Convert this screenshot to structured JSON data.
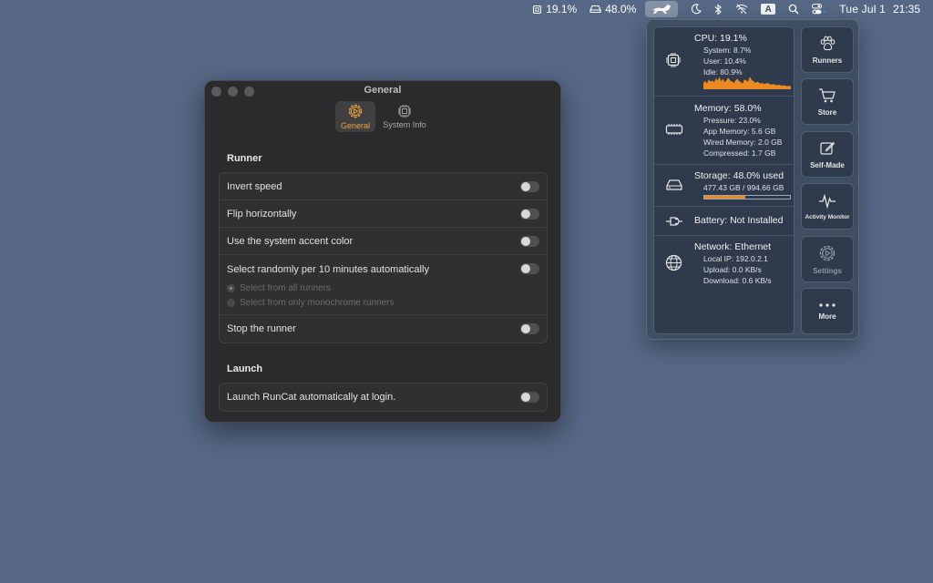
{
  "menubar": {
    "cpu_percent": "19.1%",
    "storage_percent": "48.0%",
    "input_source": "A",
    "date": "Tue Jul 1",
    "time": "21:35"
  },
  "window": {
    "title": "General",
    "tabs": [
      {
        "label": "General",
        "icon": "gear-icon",
        "active": true
      },
      {
        "label": "System Info",
        "icon": "chip-icon",
        "active": false
      }
    ],
    "runner_section": {
      "title": "Runner",
      "rows": [
        {
          "label": "Invert speed",
          "enabled": false
        },
        {
          "label": "Flip horizontally",
          "enabled": false
        },
        {
          "label": "Use the system accent color",
          "enabled": false
        },
        {
          "label": "Select randomly per 10 minutes automatically",
          "enabled": false
        },
        {
          "label": "Stop the runner",
          "enabled": false
        }
      ],
      "radio_options": [
        {
          "label": "Select from all runners",
          "selected": true
        },
        {
          "label": "Select from only monochrome runners",
          "selected": false
        }
      ]
    },
    "launch_section": {
      "title": "Launch",
      "rows": [
        {
          "label": "Launch RunCat automatically at login.",
          "enabled": false
        }
      ]
    }
  },
  "panel": {
    "cpu": {
      "title": "CPU: 19.1%",
      "system": "System:  8.7%",
      "user": "User: 10.4%",
      "idle": "Idle: 80.9%",
      "history_percent": [
        22,
        28,
        20,
        34,
        26,
        30,
        24,
        38,
        30,
        42,
        28,
        36,
        24,
        32,
        40,
        30,
        26,
        22,
        30,
        36,
        28,
        24,
        20,
        34,
        30,
        26,
        44,
        32,
        28,
        22,
        26,
        24,
        20,
        22,
        18,
        20,
        22,
        18,
        16,
        18,
        16,
        14,
        16,
        14,
        12,
        14,
        12,
        10,
        12,
        10
      ]
    },
    "memory": {
      "title": "Memory: 58.0%",
      "pressure": "Pressure: 23.0%",
      "app_memory": "App Memory:  5.6 GB",
      "wired_memory": "Wired Memory:  2.0 GB",
      "compressed": "Compressed:  1.7 GB"
    },
    "storage": {
      "title": "Storage: 48.0% used",
      "detail": "477.43 GB / 994.66 GB",
      "used_fraction": 0.48
    },
    "battery": {
      "title": "Battery: Not Installed"
    },
    "network": {
      "title": "Network: Ethernet",
      "local_ip": "Local IP: 192.0.2.1",
      "upload": "Upload:  0.0 KB/s",
      "download": "Download:  0.6 KB/s"
    },
    "actions": [
      {
        "label": "Runners",
        "icon": "paw-icon",
        "enabled": true
      },
      {
        "label": "Store",
        "icon": "cart-icon",
        "enabled": true
      },
      {
        "label": "Self-Made",
        "icon": "edit-icon",
        "enabled": true
      },
      {
        "label": "Activity Monitor",
        "icon": "pulse-icon",
        "enabled": true
      },
      {
        "label": "Settings",
        "icon": "gear-icon",
        "enabled": false
      },
      {
        "label": "More",
        "icon": "ellipsis-icon",
        "enabled": true
      }
    ]
  }
}
